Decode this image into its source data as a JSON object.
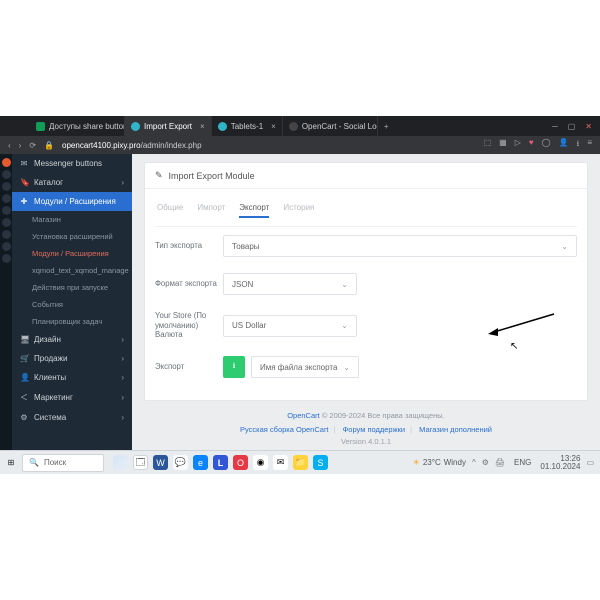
{
  "browser": {
    "tabs": [
      {
        "label": "Доступы share button - G..."
      },
      {
        "label": "Import Export"
      },
      {
        "label": "Tablets-1"
      },
      {
        "label": "OpenCart - Social Login (F..."
      }
    ],
    "url_host": "opencart4100.pixy.pro",
    "url_path": "/admin/index.php"
  },
  "sidebar": {
    "items": [
      {
        "icon": "✉",
        "label": "Messenger buttons"
      },
      {
        "icon": "🔖",
        "label": "Каталог"
      },
      {
        "icon": "✚",
        "label": "Модули / Расширения",
        "active": true
      },
      {
        "sub": true,
        "label": "Магазин"
      },
      {
        "sub": true,
        "label": "Установка расширений"
      },
      {
        "sub": true,
        "red": true,
        "label": "Модули / Расширения"
      },
      {
        "sub": true,
        "label": "xqmod_text_xqmod_manage"
      },
      {
        "sub": true,
        "label": "Действия при запуске"
      },
      {
        "sub": true,
        "label": "События"
      },
      {
        "sub": true,
        "label": "Планировщик задач"
      },
      {
        "icon": "🖥",
        "label": "Дизайн"
      },
      {
        "icon": "🛒",
        "label": "Продажи"
      },
      {
        "icon": "👤",
        "label": "Клиенты"
      },
      {
        "icon": "📣",
        "label": "Маркетинг"
      },
      {
        "icon": "⚙",
        "label": "Система"
      }
    ]
  },
  "panel": {
    "title": "Import Export Module",
    "tabs": [
      "Общие",
      "Импорт",
      "Экспорт",
      "История"
    ],
    "active_tab": 2,
    "rows": {
      "export_type": {
        "label": "Тип экспорта",
        "value": "Товары"
      },
      "export_format": {
        "label": "Формат экспорта",
        "value": "JSON"
      },
      "store_currency": {
        "label": "Your Store (По умолчанию) Валюта",
        "value": "US Dollar"
      },
      "export": {
        "label": "Экспорт",
        "value": "Имя файла экспорта"
      }
    }
  },
  "footer": {
    "copyright_link": "OpenCart",
    "copyright_text": "© 2009-2024 Все права защищены.",
    "links": [
      "Русская сборка OpenCart",
      "Форум поддержки",
      "Магазин дополнений"
    ],
    "version": "Version 4.0.1.1"
  },
  "taskbar": {
    "search": "Поиск",
    "weather_temp": "23°C",
    "weather_cond": "Windy",
    "lang": "ENG",
    "time": "13:26",
    "date": "01.10.2024"
  }
}
